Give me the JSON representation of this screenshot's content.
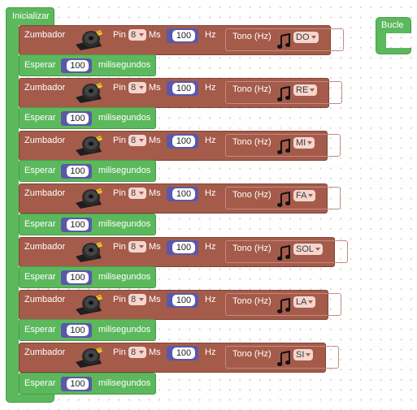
{
  "init": {
    "title": "Inicializar"
  },
  "loop": {
    "title": "Bucle"
  },
  "zumbador_blocks": [
    {
      "label": "Zumbador",
      "pin_label": "Pin",
      "pin": "8",
      "ms_label": "Ms",
      "ms": "100",
      "hz_label": "Hz",
      "tono_label": "Tono (Hz)",
      "note": "DO"
    },
    {
      "label": "Zumbador",
      "pin_label": "Pin",
      "pin": "8",
      "ms_label": "Ms",
      "ms": "100",
      "hz_label": "Hz",
      "tono_label": "Tono (Hz)",
      "note": "RE"
    },
    {
      "label": "Zumbador",
      "pin_label": "Pin",
      "pin": "8",
      "ms_label": "Ms",
      "ms": "100",
      "hz_label": "Hz",
      "tono_label": "Tono (Hz)",
      "note": "MI"
    },
    {
      "label": "Zumbador",
      "pin_label": "Pin",
      "pin": "8",
      "ms_label": "Ms",
      "ms": "100",
      "hz_label": "Hz",
      "tono_label": "Tono (Hz)",
      "note": "FA"
    },
    {
      "label": "Zumbador",
      "pin_label": "Pin",
      "pin": "8",
      "ms_label": "Ms",
      "ms": "100",
      "hz_label": "Hz",
      "tono_label": "Tono (Hz)",
      "note": "SOL"
    },
    {
      "label": "Zumbador",
      "pin_label": "Pin",
      "pin": "8",
      "ms_label": "Ms",
      "ms": "100",
      "hz_label": "Hz",
      "tono_label": "Tono (Hz)",
      "note": "LA"
    },
    {
      "label": "Zumbador",
      "pin_label": "Pin",
      "pin": "8",
      "ms_label": "Ms",
      "ms": "100",
      "hz_label": "Hz",
      "tono_label": "Tono (Hz)",
      "note": "SI"
    }
  ],
  "esperar_blocks": [
    {
      "label": "Esperar",
      "value": "100",
      "unit": "milisegundos"
    },
    {
      "label": "Esperar",
      "value": "100",
      "unit": "milisegundos"
    },
    {
      "label": "Esperar",
      "value": "100",
      "unit": "milisegundos"
    },
    {
      "label": "Esperar",
      "value": "100",
      "unit": "milisegundos"
    },
    {
      "label": "Esperar",
      "value": "100",
      "unit": "milisegundos"
    },
    {
      "label": "Esperar",
      "value": "100",
      "unit": "milisegundos"
    },
    {
      "label": "Esperar",
      "value": "100",
      "unit": "milisegundos"
    }
  ],
  "icons": {
    "buzzer": "buzzer-icon",
    "note": "music-note-icon"
  },
  "colors": {
    "zumbador": "#a55b4a",
    "control": "#5cb85c",
    "number": "#5a58a8"
  }
}
